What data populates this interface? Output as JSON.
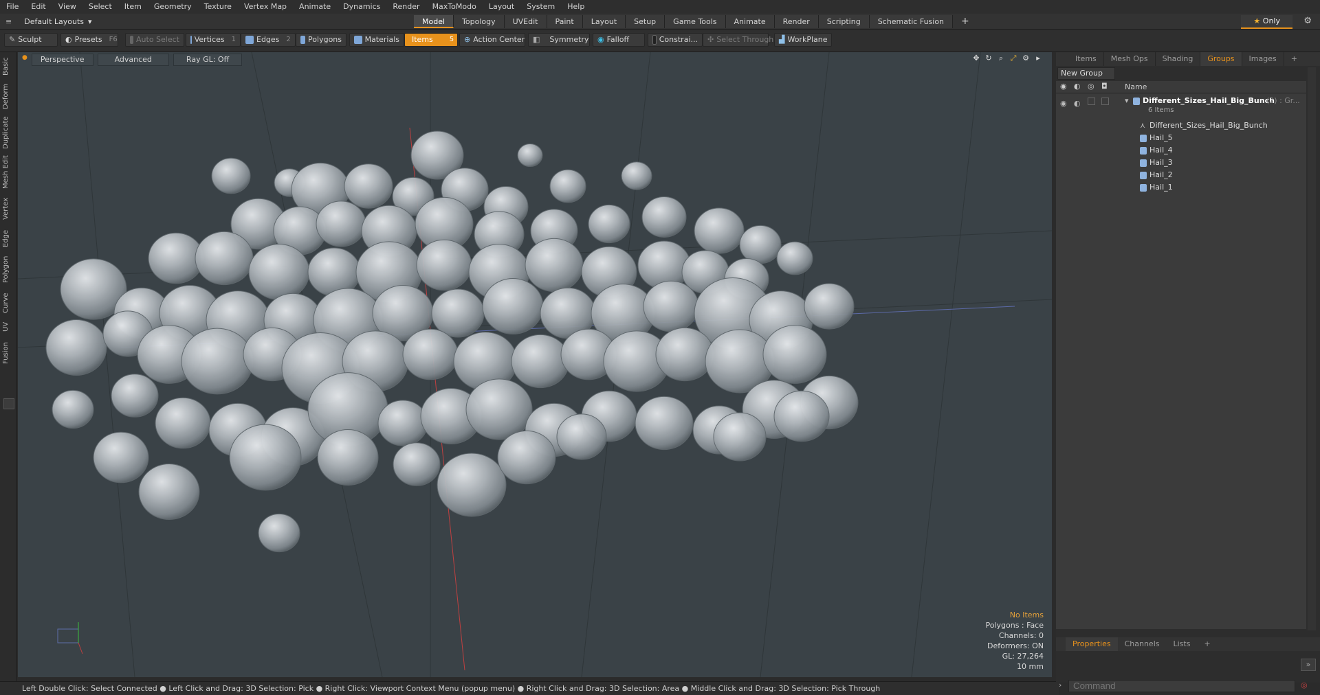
{
  "menu": [
    "File",
    "Edit",
    "View",
    "Select",
    "Item",
    "Geometry",
    "Texture",
    "Vertex Map",
    "Animate",
    "Dynamics",
    "Render",
    "MaxToModo",
    "Layout",
    "System",
    "Help"
  ],
  "layouts_label": "Default Layouts",
  "tabs": [
    "Model",
    "Topology",
    "UVEdit",
    "Paint",
    "Layout",
    "Setup",
    "Game Tools",
    "Animate",
    "Render",
    "Scripting",
    "Schematic Fusion"
  ],
  "tab_add": "+",
  "only_label": "Only",
  "toolbar": {
    "sculpt": "Sculpt",
    "presets": "Presets",
    "presets_key": "F6",
    "auto_select": "Auto Select",
    "vertices": "Vertices",
    "vertices_key": "1",
    "edges": "Edges",
    "edges_key": "2",
    "polygons": "Polygons",
    "materials": "Materials",
    "items": "Items",
    "items_key": "5",
    "action_center": "Action Center",
    "symmetry": "Symmetry",
    "falloff": "Falloff",
    "constraints": "Constrai...",
    "select_through": "Select Through",
    "workplane": "WorkPlane"
  },
  "left_tabs": [
    "Basic",
    "Deform",
    "Duplicate",
    "Mesh Edit",
    "Vertex",
    "Edge",
    "Polygon",
    "Curve",
    "UV",
    "Fusion"
  ],
  "viewport": {
    "view": "Perspective",
    "mode": "Advanced",
    "raygl": "Ray GL: Off",
    "info": {
      "selection": "No Items",
      "polygons": "Polygons : Face",
      "channels": "Channels: 0",
      "deformers": "Deformers: ON",
      "gl": "GL: 27,264",
      "units": "10 mm"
    }
  },
  "statusbar": "Left Double Click: Select Connected ● Left Click and Drag: 3D Selection: Pick ● Right Click: Viewport Context Menu (popup menu) ● Right Click and Drag: 3D Selection: Area ● Middle Click and Drag: 3D Selection: Pick Through",
  "right_panel": {
    "tabs": [
      "Items",
      "Mesh Ops",
      "Shading",
      "Groups",
      "Images"
    ],
    "active_tab": "Groups",
    "tab_add": "+",
    "new_group": "New Group",
    "name_header": "Name",
    "group": {
      "name": "Different_Sizes_Hail_Big_Bunch",
      "suffix": "(2) : Gr...",
      "count": "6 Items"
    },
    "children": [
      "Different_Sizes_Hail_Big_Bunch",
      "Hail_5",
      "Hail_4",
      "Hail_3",
      "Hail_2",
      "Hail_1"
    ],
    "bottom_tabs": [
      "Properties",
      "Channels",
      "Lists"
    ],
    "bottom_add": "+",
    "command_placeholder": "Command"
  },
  "colors": {
    "accent": "#e8921c",
    "viewport_bg": "#3a4247"
  }
}
